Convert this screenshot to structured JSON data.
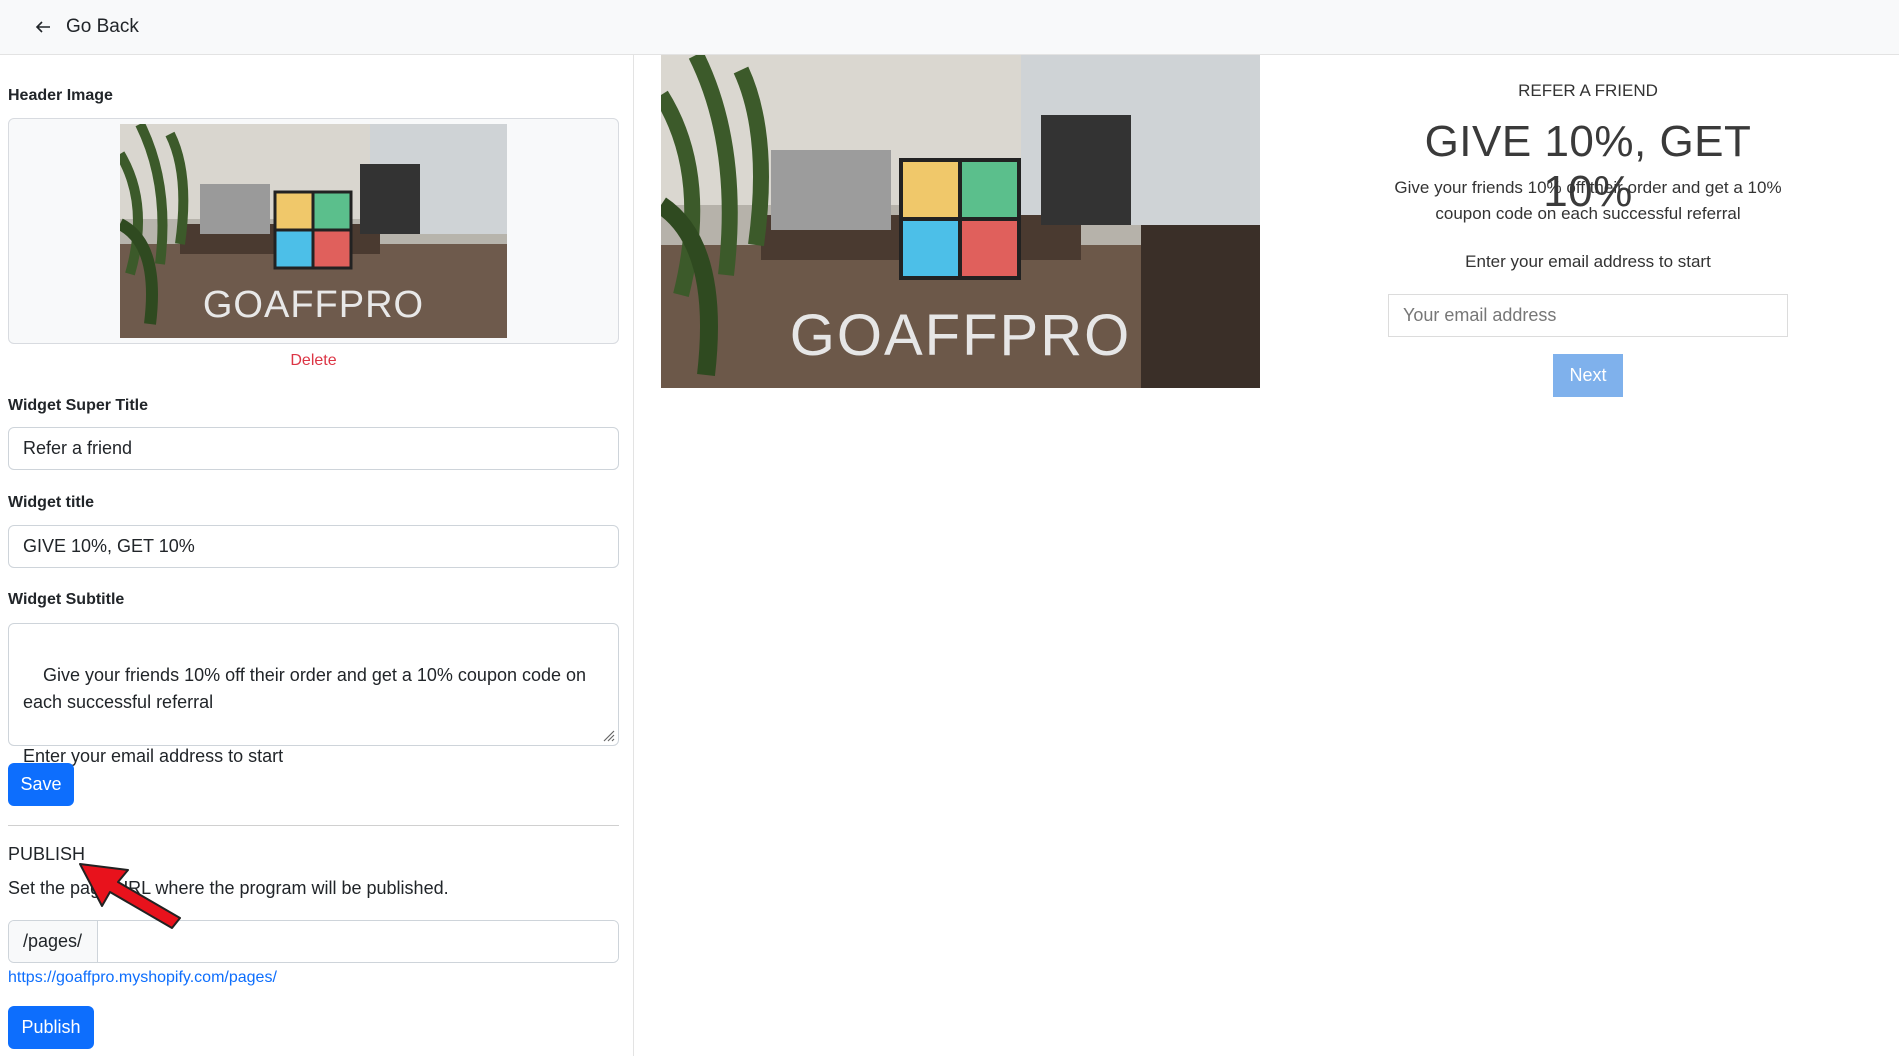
{
  "topbar": {
    "back_label": "Go Back"
  },
  "editor": {
    "header_image_label": "Header Image",
    "image_logo_text": "GOAFFPRO",
    "delete_label": "Delete",
    "super_title_label": "Widget Super Title",
    "super_title_value": "Refer a friend",
    "title_label": "Widget title",
    "title_value": "GIVE 10%, GET 10%",
    "subtitle_label": "Widget Subtitle",
    "subtitle_value": "Give your friends 10% off their order and get a 10% coupon code on\neach successful referral\n\nEnter your email address to start",
    "save_label": "Save"
  },
  "publish": {
    "heading": "PUBLISH",
    "description": "Set the page URL where the program will be published.",
    "url_prefix": "/pages/",
    "url_value": "",
    "url_link": "https://goaffpro.myshopify.com/pages/",
    "publish_label": "Publish"
  },
  "preview": {
    "logo_text": "GOAFFPRO",
    "super_title": "REFER A FRIEND",
    "title": "GIVE 10%, GET 10%",
    "subtitle": "Give your friends 10% off their order and get a 10% coupon code on each successful referral",
    "prompt": "Enter your email address to start",
    "email_placeholder": "Your email address",
    "next_label": "Next"
  },
  "colors": {
    "primary": "#0d6efd",
    "danger": "#dc3545",
    "next_button": "#7fb1ec",
    "annotation_arrow": "#e8121c"
  }
}
